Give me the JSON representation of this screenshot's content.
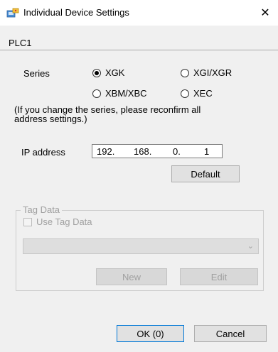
{
  "window": {
    "title": "Individual Device Settings",
    "close_glyph": "✕"
  },
  "device": {
    "name": "PLC1"
  },
  "series": {
    "label": "Series",
    "options": [
      {
        "label": "XGK",
        "selected": true
      },
      {
        "label": "XGI/XGR",
        "selected": false
      },
      {
        "label": "XBM/XBC",
        "selected": false
      },
      {
        "label": "XEC",
        "selected": false
      }
    ],
    "note_line1": "(If you change the series, please reconfirm all",
    "note_line2": "address settings.)"
  },
  "ip": {
    "label": "IP address",
    "octets": [
      "192.",
      "168.",
      "0.",
      "1"
    ]
  },
  "buttons": {
    "default": "Default",
    "new": "New",
    "edit": "Edit",
    "ok": "OK (0)",
    "cancel": "Cancel"
  },
  "tag_data": {
    "group_label": "Tag Data",
    "checkbox_label": "Use Tag Data",
    "checked": false,
    "combo_value": ""
  }
}
